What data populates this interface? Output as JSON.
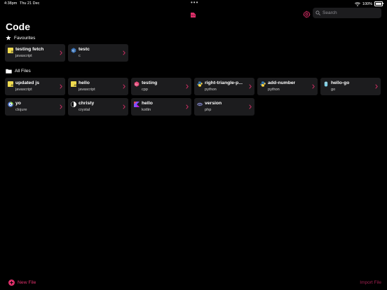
{
  "status_bar": {
    "time": "4:38pm",
    "date": "Thu 21 Dec",
    "battery": "100%"
  },
  "colors": {
    "accent": "#e0306b",
    "card_bg": "#1c1c1e",
    "background": "#000000"
  },
  "search": {
    "placeholder": "Search"
  },
  "page": {
    "title": "Code"
  },
  "favourites": {
    "header": "Favourites",
    "items": [
      {
        "name": "testing fetch",
        "language": "javascript",
        "icon": "javascript-icon"
      },
      {
        "name": "testc",
        "language": "c",
        "icon": "c-icon"
      }
    ]
  },
  "all_files": {
    "header": "All Files",
    "items": [
      {
        "name": "updated js",
        "language": "javascript",
        "icon": "javascript-icon"
      },
      {
        "name": "hello",
        "language": "javascript",
        "icon": "javascript-icon"
      },
      {
        "name": "testing",
        "language": "cpp",
        "icon": "cpp-icon"
      },
      {
        "name": "right-triangle-p...",
        "language": "python",
        "icon": "python-icon"
      },
      {
        "name": "add-number",
        "language": "python",
        "icon": "python-icon"
      },
      {
        "name": "hello-go",
        "language": "go",
        "icon": "go-icon"
      },
      {
        "name": "yo",
        "language": "clojure",
        "icon": "clojure-icon"
      },
      {
        "name": "christy",
        "language": "crystal",
        "icon": "crystal-icon"
      },
      {
        "name": "hello",
        "language": "kotlin",
        "icon": "kotlin-icon"
      },
      {
        "name": "version",
        "language": "php",
        "icon": "php-icon"
      }
    ]
  },
  "footer": {
    "new_file": "New File",
    "import_file": "Import File"
  }
}
